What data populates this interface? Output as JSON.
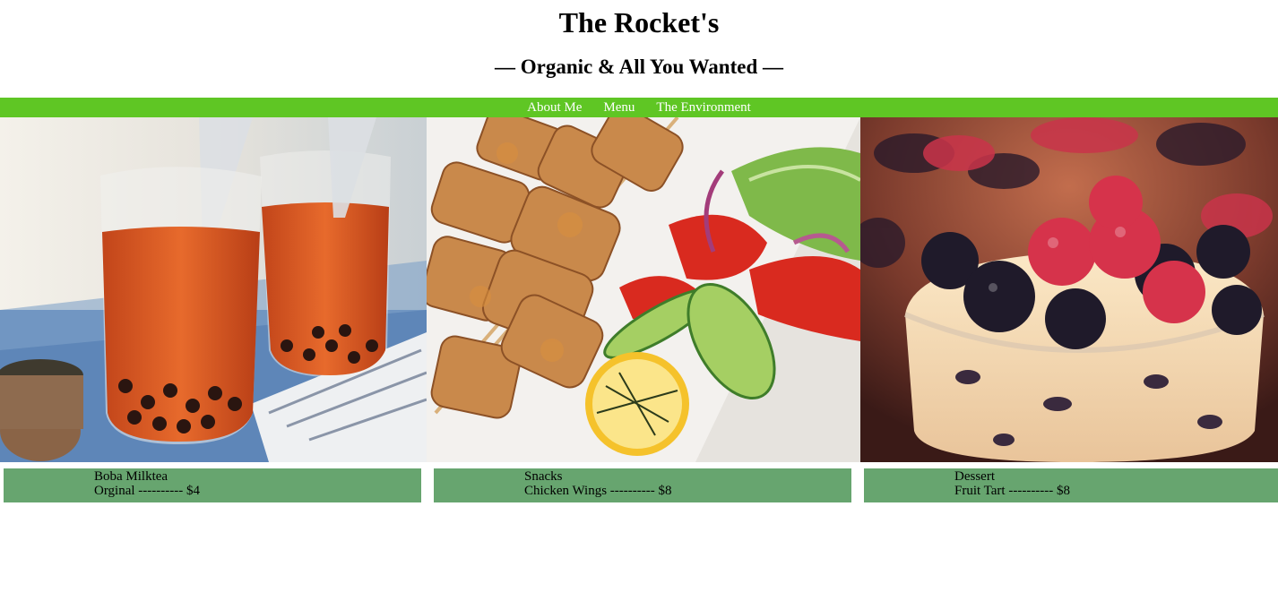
{
  "header": {
    "title": "The Rocket's",
    "tagline": "— Organic & All You Wanted —"
  },
  "nav": {
    "items": [
      {
        "label": "About Me"
      },
      {
        "label": "Menu"
      },
      {
        "label": "The Environment"
      }
    ]
  },
  "menu": [
    {
      "category": "Boba Milktea",
      "item": "Orginal ---------- $4",
      "image": "boba-milktea-photo"
    },
    {
      "category": "Snacks",
      "item": "Chicken Wings ---------- $8",
      "image": "chicken-skewers-photo"
    },
    {
      "category": "Dessert",
      "item": "Fruit Tart ---------- $8",
      "image": "berry-dessert-photo"
    }
  ],
  "colors": {
    "nav_bar": "#5fc624",
    "caption_bar": "#67a56f",
    "nav_text": "#ffffff"
  }
}
